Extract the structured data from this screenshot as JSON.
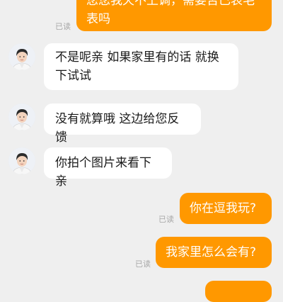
{
  "chat": {
    "read_label": "已读",
    "messages": [
      {
        "side": "out",
        "lines": [
          "您您我天不上调，需要否已表毛",
          "表吗"
        ]
      },
      {
        "side": "in",
        "lines": [
          "不是呢亲  如果家里有的话 就换",
          "下试试"
        ]
      },
      {
        "side": "in",
        "lines": [
          "没有就算哦  这边给您反馈"
        ]
      },
      {
        "side": "in",
        "lines": [
          "你拍个图片来看下亲"
        ]
      },
      {
        "side": "out",
        "lines": [
          "你在逗我玩?"
        ]
      },
      {
        "side": "out",
        "lines": [
          "我家里怎么会有?"
        ]
      },
      {
        "side": "out",
        "lines": [
          ""
        ]
      }
    ]
  },
  "colors": {
    "outgoing": "#ff9800",
    "incoming": "#ffffff",
    "background": "#efefef"
  },
  "icons": {
    "agent_avatar": "agent-avatar-icon"
  }
}
